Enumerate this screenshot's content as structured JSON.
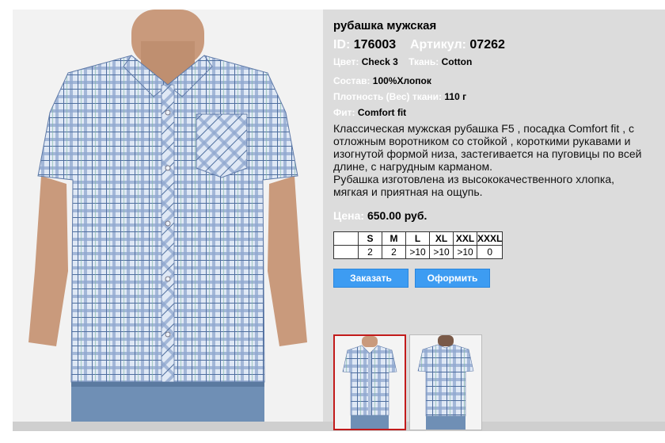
{
  "product": {
    "title": "рубашка мужская",
    "id_label": "ID:",
    "id_value": "176003",
    "article_label": "Артикул:",
    "article_value": "07262",
    "color_label": "Цвет:",
    "color_value": "Check 3",
    "fabric_label": "Ткань:",
    "fabric_value": "Cotton",
    "composition_label": "Состав:",
    "composition_value": "100%Хлопок",
    "density_label": "Плотность (Вес) ткани:",
    "density_value": "110 г",
    "fit_label": "Фит:",
    "fit_value": "Comfort fit",
    "description_line1": "Классическая мужская рубашка F5 , посадка  Comfort fit , с отложным воротником со  стойкой , короткими рукавами и изогнутой формой  низа, застегивается на пуговицы по всей длине, с нагрудным карманом.",
    "description_line2": "Рубашка изготовлена из высококачественного хлопка,  мягкая и приятная на ощупь.",
    "price_label": "Цена:",
    "price_value": "650.00 руб."
  },
  "sizes": {
    "headers": [
      "",
      "S",
      "M",
      "L",
      "XL",
      "XXL",
      "XXXL"
    ],
    "values": [
      "",
      "2",
      "2",
      ">10",
      ">10",
      ">10",
      "0"
    ]
  },
  "buttons": {
    "order_label": "Заказать",
    "checkout_label": "Оформить"
  },
  "colors": {
    "accent": "#3d9cf2",
    "panel": "#dcdcdc",
    "thumb_selected_border": "#c21b1b"
  }
}
